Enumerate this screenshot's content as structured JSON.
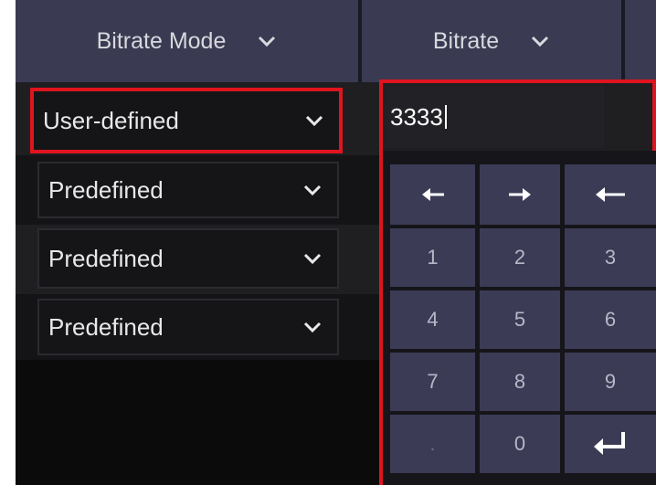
{
  "header": {
    "bitrate_mode_label": "Bitrate Mode",
    "bitrate_label": "Bitrate"
  },
  "rows": [
    {
      "mode": "User-defined",
      "highlighted": true
    },
    {
      "mode": "Predefined",
      "highlighted": false
    },
    {
      "mode": "Predefined",
      "highlighted": false
    },
    {
      "mode": "Predefined",
      "highlighted": false
    }
  ],
  "bitrate_input": {
    "value": "3333"
  },
  "keypad": {
    "keys": [
      "←",
      "→",
      "⌫",
      "1",
      "2",
      "3",
      "4",
      "5",
      "6",
      "7",
      "8",
      "9",
      ".",
      "0",
      "↵"
    ],
    "icons": {
      "left": "arrow-left-icon",
      "right": "arrow-right-icon",
      "backspace": "backspace-icon",
      "enter": "enter-icon"
    }
  },
  "colors": {
    "highlight": "#e0141e",
    "header": "#3a3a52",
    "key": "#3b3b56"
  }
}
